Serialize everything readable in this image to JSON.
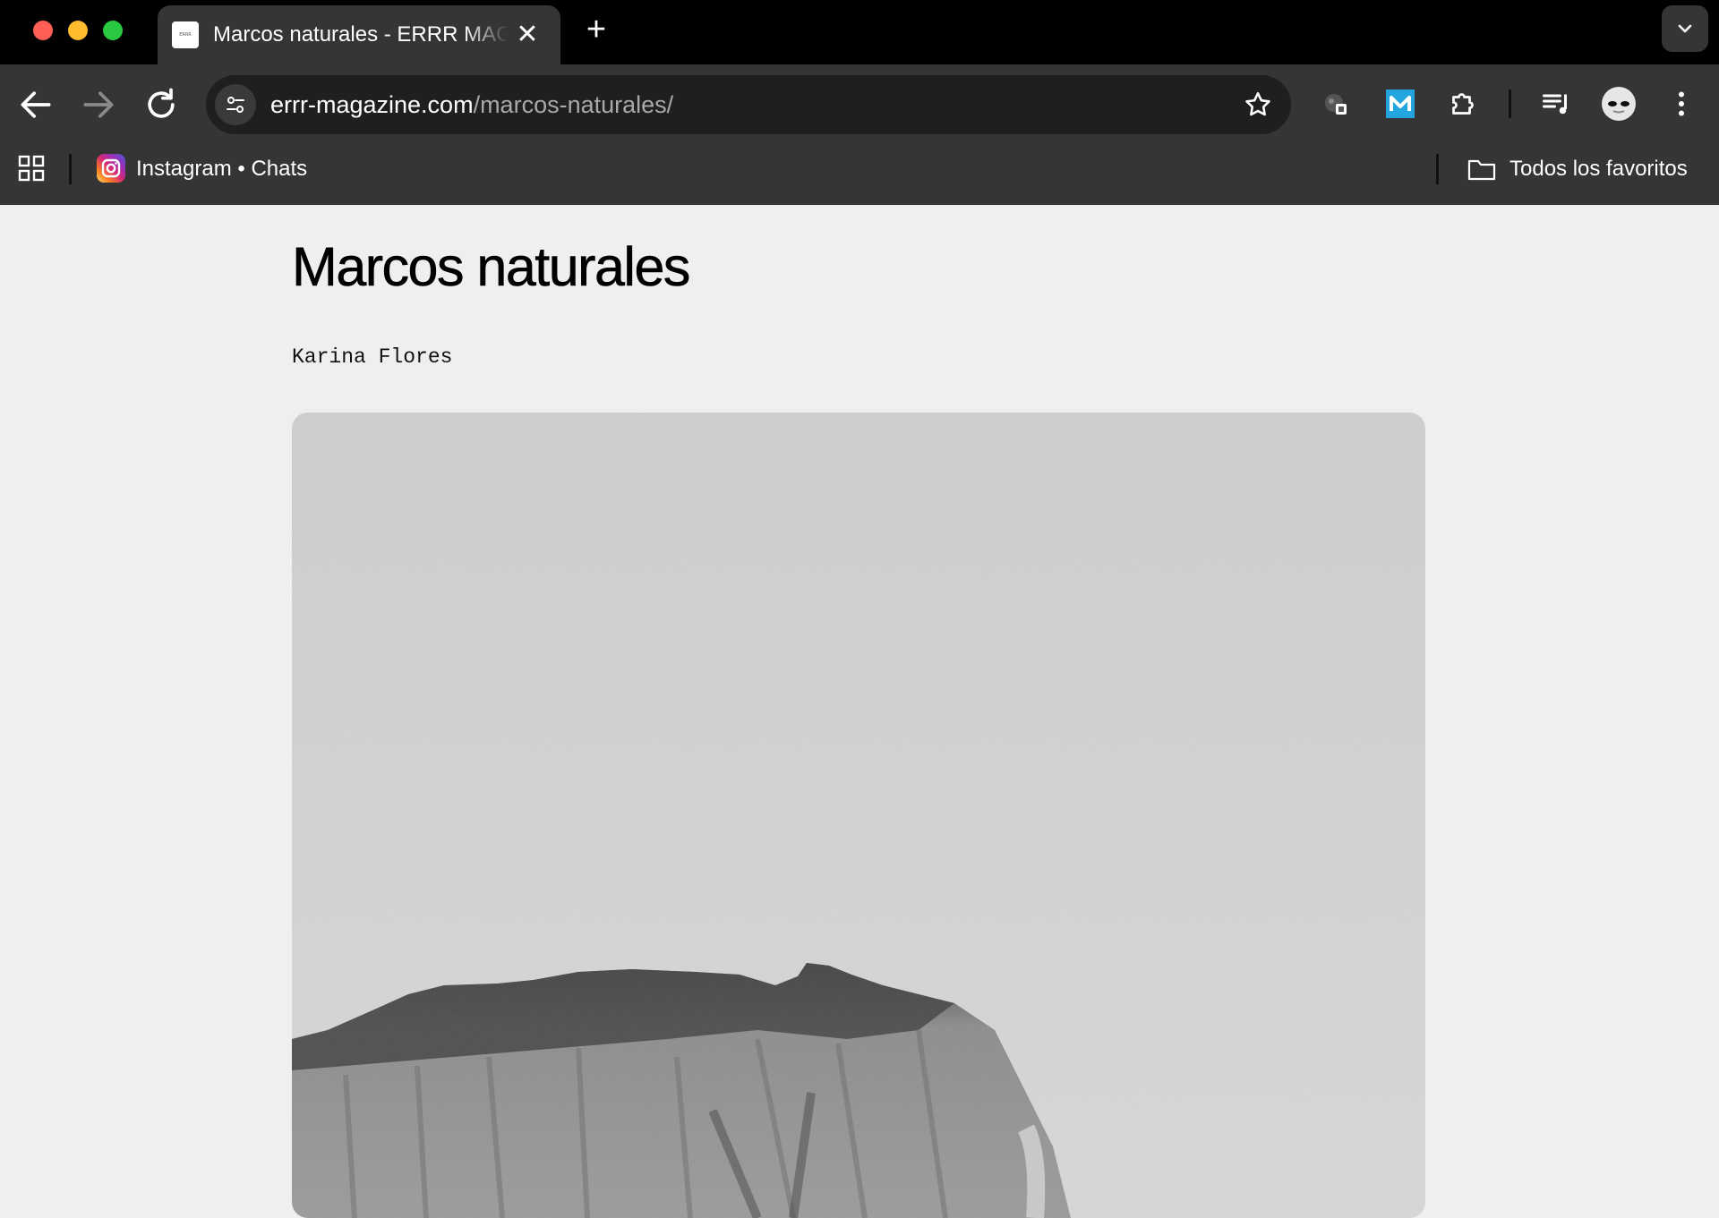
{
  "browser": {
    "tab": {
      "title": "Marcos naturales - ERRR MAGAZINE",
      "favicon_text": "ERRR"
    },
    "address": {
      "host": "errr-magazine.com",
      "path": "/marcos-naturales/"
    },
    "bookmarks": {
      "items": [
        {
          "label": "Instagram • Chats",
          "icon": "instagram-icon"
        }
      ],
      "all_favorites": "Todos los favoritos"
    },
    "icons": [
      "back-icon",
      "forward-icon",
      "reload-icon",
      "site-info-icon",
      "star-icon",
      "extension-icon",
      "mailchimp-icon",
      "puzzle-icon",
      "media-icon",
      "avatar",
      "menu-icon",
      "apps-icon",
      "folder-icon"
    ]
  },
  "article": {
    "title": "Marcos naturales",
    "author": "Karina Flores",
    "image_subject": "cliff-photo"
  }
}
